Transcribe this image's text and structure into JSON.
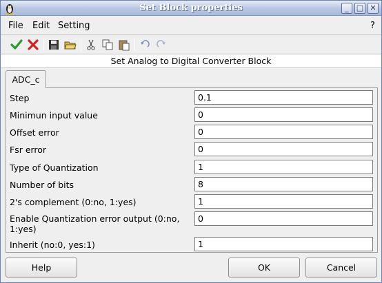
{
  "window": {
    "title": "Set Block properties"
  },
  "title_buttons": {
    "minimize": "_",
    "maximize": "□",
    "close": "✕"
  },
  "menu": {
    "items": [
      "File",
      "Edit",
      "Setting"
    ],
    "help": "?"
  },
  "toolbar": {
    "icons": [
      "ok-check-icon",
      "cancel-x-icon",
      "save-icon",
      "open-folder-icon",
      "cut-icon",
      "copy-icon",
      "paste-icon",
      "undo-icon",
      "redo-icon"
    ]
  },
  "header": {
    "text": "Set Analog to Digital Converter Block"
  },
  "tab": {
    "label": "ADC_c"
  },
  "fields": [
    {
      "label": "Step",
      "value": "0.1"
    },
    {
      "label": "Minimun input value",
      "value": "0"
    },
    {
      "label": "Offset error",
      "value": "0"
    },
    {
      "label": "Fsr error",
      "value": "0"
    },
    {
      "label": "Type of Quantization",
      "value": "1"
    },
    {
      "label": "Number of bits",
      "value": "8"
    },
    {
      "label": "2's complement (0:no, 1:yes)",
      "value": "1"
    },
    {
      "label": "Enable Quantization error output (0:no, 1:yes)",
      "value": "0"
    },
    {
      "label": "Inherit (no:0, yes:1)",
      "value": "1"
    }
  ],
  "buttons": {
    "help": "Help",
    "ok": "OK",
    "cancel": "Cancel"
  },
  "colors": {
    "title_gradient_top": "#e7ecf6",
    "title_gradient_bottom": "#a9badb",
    "ok_green": "#2e9a2e",
    "cancel_red": "#d42020"
  }
}
